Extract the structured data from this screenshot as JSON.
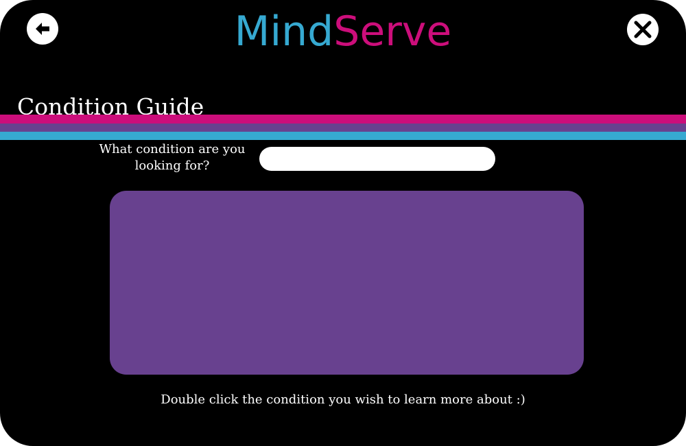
{
  "app": {
    "title_part1": "Mind",
    "title_part2": "Serve"
  },
  "nav": {
    "back_icon": "arrow-left-icon",
    "close_icon": "close-icon"
  },
  "page": {
    "title": "Condition Guide"
  },
  "search": {
    "label": "What condition are you looking for?",
    "value": "",
    "placeholder": ""
  },
  "results": {
    "items": []
  },
  "hint": {
    "text": "Double click the condition you wish to learn more about :)"
  },
  "colors": {
    "background": "#000000",
    "brand_blue": "#36a9d1",
    "brand_pink": "#cc0e7b",
    "brand_purple": "#68418f",
    "text": "#ffffff"
  }
}
